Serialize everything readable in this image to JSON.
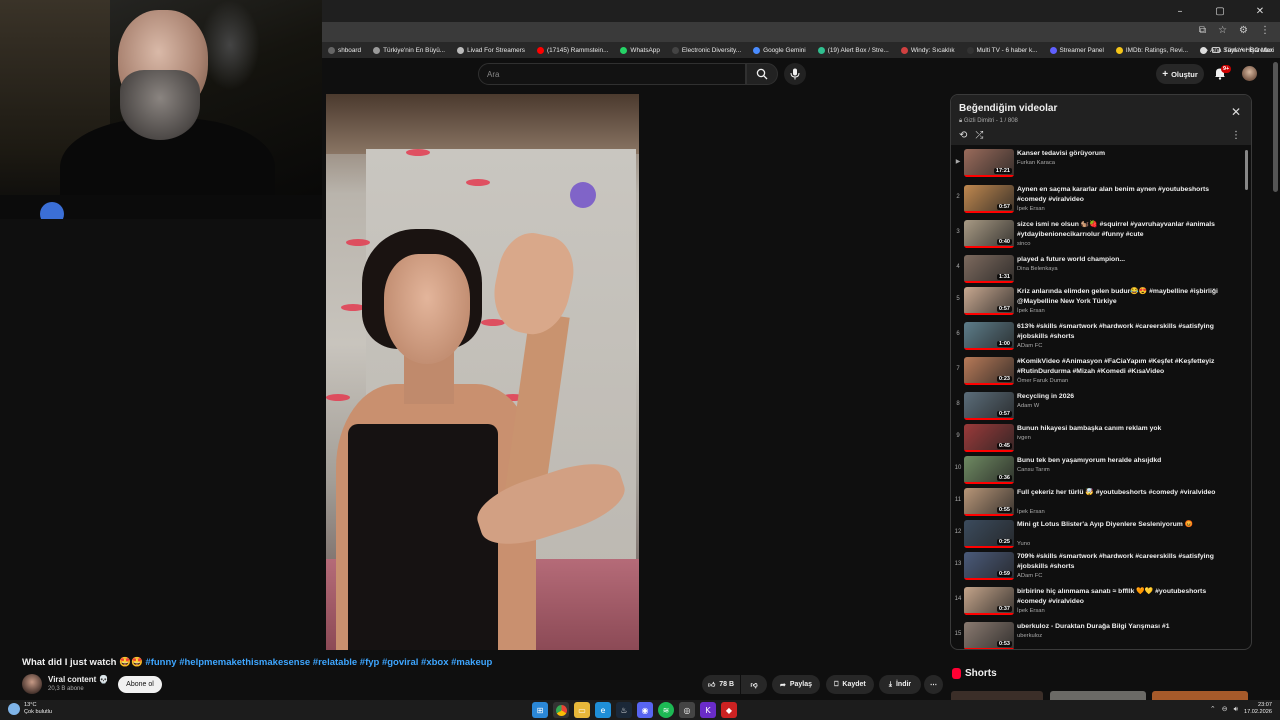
{
  "browser": {
    "window_controls": [
      "–",
      "▢",
      "✕"
    ],
    "bookmarks": [
      {
        "label": "shboard",
        "color": "#666666"
      },
      {
        "label": "Türkiye'nin En Büyü...",
        "color": "#9a9a9a"
      },
      {
        "label": "Livad For Streamers",
        "color": "#bbbbbb"
      },
      {
        "label": "(17145) Rammstein...",
        "color": "#ff0000"
      },
      {
        "label": "WhatsApp",
        "color": "#25d366"
      },
      {
        "label": "Electronic Diversity...",
        "color": "#444444"
      },
      {
        "label": "Google Gemini",
        "color": "#4a8cff"
      },
      {
        "label": "(19) Alert Box / Stre...",
        "color": "#30c090"
      },
      {
        "label": "Windy: Sıcaklık",
        "color": "#d04040"
      },
      {
        "label": "Multi TV - 6 haber k...",
        "color": "#333333"
      },
      {
        "label": "Streamer Panel",
        "color": "#6060ff"
      },
      {
        "label": "IMDb: Ratings, Revi...",
        "color": "#f5c518"
      },
      {
        "label": "Ana Sayfa • HBO Max",
        "color": "#dddddd"
      }
    ],
    "bookmarks_more": "»",
    "all_bookmarks": "Tüm Yer İşaretleri"
  },
  "header": {
    "search_placeholder": "Ara",
    "create_label": "Oluştur",
    "notif_badge": "9+"
  },
  "video": {
    "title_text": "What did I just watch 🤩🤩",
    "title_tags": "#funny #helpmemakethismakesense #relatable #fyp #goviral #xbox #makeup",
    "channel_name": "Viral content 💀",
    "subscribers": "20,3 B abone",
    "subscribe_label": "Abone ol",
    "likes": "78 B",
    "share_label": "Paylaş",
    "save_label": "Kaydet",
    "download_label": "İndir",
    "more_label": "⋯"
  },
  "playlist": {
    "title": "Beğendiğim videolar",
    "subtitle": "Gizli Dimitri - 1 / 808",
    "items": [
      {
        "index": "▶",
        "title": "Kanser tedavisi görüyorum",
        "channel": "Furkan Karaca",
        "duration": "17:21",
        "color": "#9a6b5b"
      },
      {
        "index": "2",
        "title": "Aynen en saçma kararlar alan benim aynen #youtubeshorts #comedy #viralvideo",
        "channel": "İpek Ersan",
        "duration": "0:57",
        "color": "#c0884f"
      },
      {
        "index": "3",
        "title": "sizce ismi ne olsun 🐿️🍓 #squirrel #yavruhayvanlar #animals #ytdayibenionecikarrıolur #funny #cute",
        "channel": "sinco",
        "duration": "0:40",
        "color": "#a89a84"
      },
      {
        "index": "4",
        "title": "played a future world champion...",
        "channel": "Dina Belenkaya",
        "duration": "1:31",
        "color": "#7d6a5e"
      },
      {
        "index": "5",
        "title": "Kriz anlarında elimden gelen budur😂😍 #maybelline #işbirliği @Maybelline New York Türkiye",
        "channel": "İpek Ersan",
        "duration": "0:57",
        "color": "#c8a890"
      },
      {
        "index": "6",
        "title": "613% #skills #smartwork #hardwork #careerskills #satisfying #jobskills #shorts",
        "channel": "ADam FC",
        "duration": "1:00",
        "color": "#5d7d8a"
      },
      {
        "index": "7",
        "title": "#KomikVideo #Animasyon #FaCiaYapım #Keşfet #Keşfetteyiz #RutinDurdurma #Mizah #Komedi #KısaVideo",
        "channel": "Ömer Faruk Duman",
        "duration": "0:23",
        "color": "#b87a58"
      },
      {
        "index": "8",
        "title": "Recycling in 2026",
        "channel": "Adam W",
        "duration": "0:57",
        "color": "#5b6d7a"
      },
      {
        "index": "9",
        "title": "Bunun hikayesi bambaşka canım reklam yok",
        "channel": "ivgen",
        "duration": "0:45",
        "color": "#9b3a3a"
      },
      {
        "index": "10",
        "title": "Bunu tek ben yaşamıyorum heralde ahsıjdkd",
        "channel": "Cansu Tarım",
        "duration": "0:36",
        "color": "#6f8a62"
      },
      {
        "index": "11",
        "title": "Full çekeriz her türlü 🤯 #youtubeshorts #comedy #viralvideo",
        "channel": "İpek Ersan",
        "duration": "0:55",
        "color": "#b89678"
      },
      {
        "index": "12",
        "title": "Mini gt Lotus Blister'a Ayıp Diyenlere Sesleniyorum 😡",
        "channel": "Yuno",
        "duration": "0:25",
        "color": "#3b4b5d"
      },
      {
        "index": "13",
        "title": "709% #skills #smartwork #hardwork #careerskills #satisfying #jobskills #shorts",
        "channel": "ADam FC",
        "duration": "0:59",
        "color": "#4a5a7a"
      },
      {
        "index": "14",
        "title": "birbirine hiç alınmama sanatı ≈ bffllk 🧡💛 #youtubeshorts #comedy #viralvideo",
        "channel": "İpek Ersan",
        "duration": "0:37",
        "color": "#c4a48a"
      },
      {
        "index": "15",
        "title": "uberkuloz - Duraktan Durağa Bilgi Yarışması #1",
        "channel": "uberkuloz",
        "duration": "0:53",
        "color": "#8a7a70"
      }
    ]
  },
  "shorts": {
    "heading": "Shorts"
  },
  "taskbar": {
    "temp": "13°C",
    "weather": "Çok bulutlu",
    "time": "23:07",
    "date": "17.02.2026"
  }
}
